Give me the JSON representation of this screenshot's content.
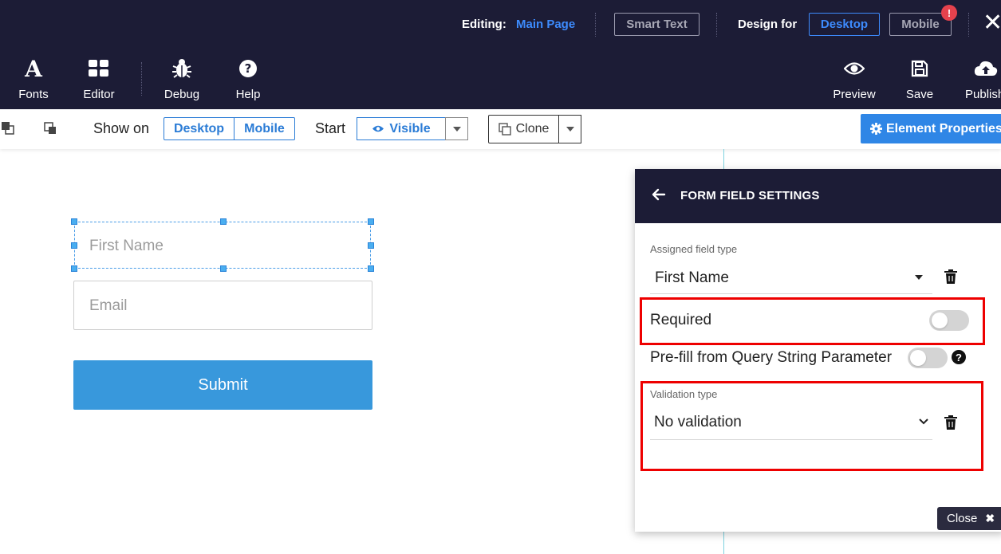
{
  "header": {
    "editing_label": "Editing:",
    "editing_page": "Main Page",
    "smart_text": "Smart Text",
    "design_for": "Design for",
    "design_desktop": "Desktop",
    "design_mobile": "Mobile",
    "alert_badge": "!",
    "tools_left": [
      {
        "label": "Fonts",
        "icon": "font-icon"
      },
      {
        "label": "Editor",
        "icon": "grid-icon"
      },
      {
        "label": "Debug",
        "icon": "bug-icon"
      },
      {
        "label": "Help",
        "icon": "help-icon"
      }
    ],
    "tools_right": [
      {
        "label": "Preview",
        "icon": "eye-icon"
      },
      {
        "label": "Save",
        "icon": "floppy-icon"
      },
      {
        "label": "Publish",
        "icon": "cloud-upload-icon"
      }
    ]
  },
  "toolbar": {
    "show_on": "Show on",
    "show_desktop": "Desktop",
    "show_mobile": "Mobile",
    "start": "Start",
    "visible": "Visible",
    "clone": "Clone",
    "element_properties": "Element Properties"
  },
  "canvas": {
    "first_name_placeholder": "First Name",
    "email_placeholder": "Email",
    "submit_label": "Submit"
  },
  "panel": {
    "title": "FORM FIELD SETTINGS",
    "assigned_label": "Assigned field type",
    "assigned_value": "First Name",
    "required_label": "Required",
    "required_on": false,
    "prefill_label": "Pre-fill from Query String Parameter",
    "prefill_on": false,
    "validation_label": "Validation type",
    "validation_value": "No validation",
    "close_label": "Close"
  },
  "colors": {
    "header_bg": "#1c1c36",
    "accent": "#2f86e6",
    "highlight": "#ee0000",
    "submit": "#3898dc"
  }
}
